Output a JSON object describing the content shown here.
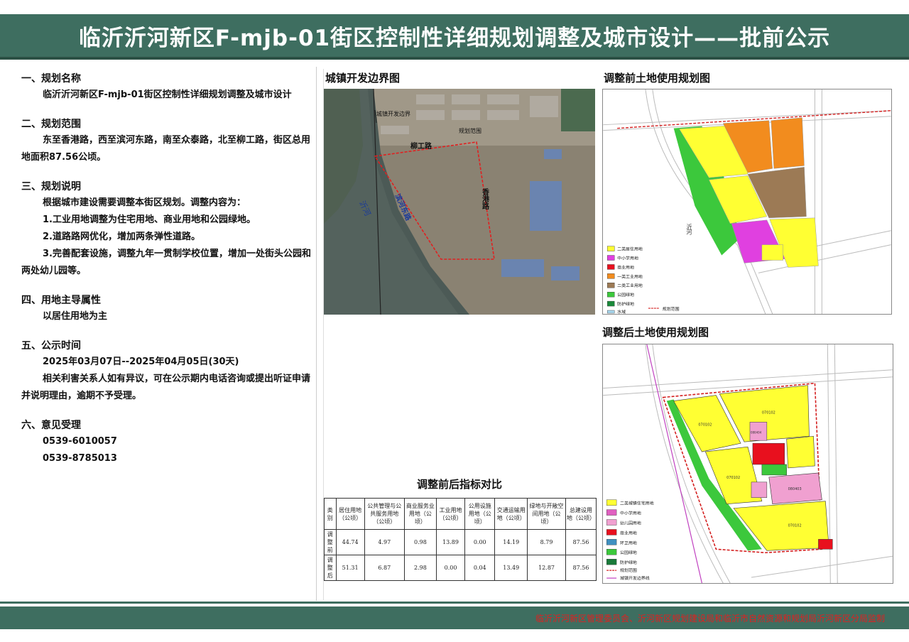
{
  "header": {
    "title": "临沂沂河新区F-mjb-01街区控制性详细规划调整及城市设计——批前公示"
  },
  "sections": {
    "s1": {
      "title": "一、规划名称",
      "body": "临沂沂河新区F-mjb-01街区控制性详细规划调整及城市设计"
    },
    "s2": {
      "title": "二、规划范围",
      "body": "东至香港路，西至滨河东路，南至众泰路，北至柳工路，街区总用地面积87.56公顷。"
    },
    "s3": {
      "title": "三、规划说明",
      "intro": "根据城市建设需要调整本街区规划。调整内容为：",
      "items": [
        "1.工业用地调整为住宅用地、商业用地和公园绿地。",
        "2.道路路网优化，增加两条弹性道路。",
        "3.完善配套设施，调整九年一贯制学校位置，增加一处街头公园和两处幼儿园等。"
      ]
    },
    "s4": {
      "title": "四、用地主导属性",
      "body": "以居住用地为主"
    },
    "s5": {
      "title": "五、公示时间",
      "date": "2025年03月07日--2025年04月05日(30天)",
      "note": "相关利害关系人如有异议，可在公示期内电话咨询或提出听证申请并说明理由，逾期不予受理。"
    },
    "s6": {
      "title": "六、意见受理",
      "phone1": "0539-6010057",
      "phone2": "0539-8785013"
    }
  },
  "maps": {
    "boundary": {
      "title": "城镇开发边界图",
      "label_boundary": "城镇开发边界",
      "label_range": "规划范围",
      "road_north": "柳工路",
      "road_east": "香港路",
      "road_west": "滨河东路",
      "river": "沂河"
    },
    "before": {
      "title": "调整前土地使用规划图",
      "river": "沂河",
      "legend": [
        "二类居住用地",
        "中小学用地",
        "商业用地",
        "一类工业用地",
        "二类工业用地",
        "公园绿地",
        "防护绿地",
        "水域",
        "规划范围"
      ]
    },
    "after": {
      "title": "调整后土地使用规划图",
      "legend": [
        "二类城镇住宅用地",
        "中小学用地",
        "幼儿园用地",
        "商业用地",
        "环卫用地",
        "公园绿地",
        "防护绿地",
        "规划范围",
        "城镇开发边界线"
      ],
      "codes": {
        "res": "070102",
        "school": "080403",
        "kinder": "080404"
      }
    }
  },
  "table": {
    "title": "调整前后指标对比",
    "headers": [
      "类别",
      "居住用地（公顷）",
      "公共管理与公共服务用地（公顷）",
      "商业服务业用地（公顷）",
      "工业用地（公顷）",
      "公用设施用地（公顷）",
      "交通运输用地（公顷）",
      "绿地与开敞空间用地（公顷）",
      "总建设用地（公顷）"
    ],
    "rows": [
      [
        "调整前",
        "44.74",
        "4.97",
        "0.98",
        "13.89",
        "0.00",
        "14.19",
        "8.79",
        "87.56"
      ],
      [
        "调整后",
        "51.31",
        "6.87",
        "2.98",
        "0.00",
        "0.04",
        "13.49",
        "12.87",
        "87.56"
      ]
    ]
  },
  "footer": {
    "text": "临沂沂河新区管理委员会、沂河新区规划建设局和临沂市自然资源和规划局沂河新区分局监制"
  },
  "colors": {
    "header_bg": "#3e6e60",
    "footer_text": "#e02020",
    "residential": "#ffff33",
    "commercial": "#e8101e",
    "park": "#3cc83c",
    "boundary": "#d42020"
  }
}
